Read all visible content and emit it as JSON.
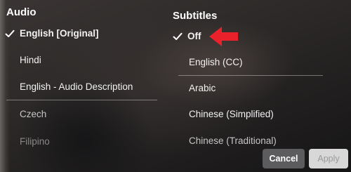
{
  "audio": {
    "heading": "Audio",
    "items": [
      {
        "label": "English [Original]"
      },
      {
        "label": "Hindi"
      },
      {
        "label": "English - Audio Description"
      },
      {
        "label": "Czech"
      },
      {
        "label": "Filipino"
      }
    ],
    "selected_index": 0
  },
  "subtitles": {
    "heading": "Subtitles",
    "items": [
      {
        "label": "Off"
      },
      {
        "label": "English (CC)"
      },
      {
        "label": "Arabic"
      },
      {
        "label": "Chinese (Simplified)"
      },
      {
        "label": "Chinese (Traditional)"
      }
    ],
    "selected_index": 0
  },
  "buttons": {
    "cancel_label": "Cancel",
    "apply_label": "Apply"
  },
  "colors": {
    "annotation_arrow": "#e8212b",
    "cancel_button_bg": "#5c5c5e",
    "apply_button_bg": "#d8d8d8"
  }
}
